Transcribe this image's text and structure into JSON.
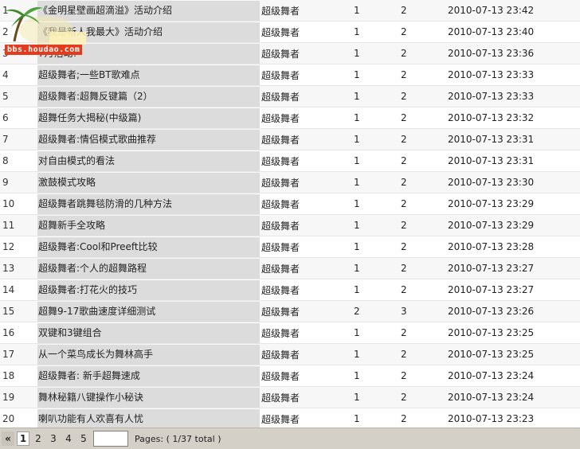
{
  "rows": [
    {
      "no": "1",
      "title": "《金明星壁画超滴溢》活动介绍",
      "author": "超级舞者",
      "a": "1",
      "b": "2",
      "date": "2010-07-13 23:42"
    },
    {
      "no": "2",
      "title": "《我是新人我最大》活动介绍",
      "author": "超级舞者",
      "a": "1",
      "b": "2",
      "date": "2010-07-13 23:40"
    },
    {
      "no": "3",
      "title": "7月活动!",
      "author": "超级舞者",
      "a": "1",
      "b": "2",
      "date": "2010-07-13 23:36"
    },
    {
      "no": "4",
      "title": "超级舞者;一些BT歌难点",
      "author": "超级舞者",
      "a": "1",
      "b": "2",
      "date": "2010-07-13 23:33"
    },
    {
      "no": "5",
      "title": "超级舞者:超舞反键篇（2）",
      "author": "超级舞者",
      "a": "1",
      "b": "2",
      "date": "2010-07-13 23:33"
    },
    {
      "no": "6",
      "title": "超舞任务大揭秘(中级篇)",
      "author": "超级舞者",
      "a": "1",
      "b": "2",
      "date": "2010-07-13 23:32"
    },
    {
      "no": "7",
      "title": "超级舞者:情侣模式歌曲推荐",
      "author": "超级舞者",
      "a": "1",
      "b": "2",
      "date": "2010-07-13 23:31"
    },
    {
      "no": "8",
      "title": "对自由模式的看法",
      "author": "超级舞者",
      "a": "1",
      "b": "2",
      "date": "2010-07-13 23:31"
    },
    {
      "no": "9",
      "title": "激鼓模式攻略",
      "author": "超级舞者",
      "a": "1",
      "b": "2",
      "date": "2010-07-13 23:30"
    },
    {
      "no": "10",
      "title": "超级舞者跳舞毯防滑的几种方法",
      "author": "超级舞者",
      "a": "1",
      "b": "2",
      "date": "2010-07-13 23:29"
    },
    {
      "no": "11",
      "title": "超舞新手全攻略",
      "author": "超级舞者",
      "a": "1",
      "b": "2",
      "date": "2010-07-13 23:29"
    },
    {
      "no": "12",
      "title": "超级舞者:Cool和Preeft比较",
      "author": "超级舞者",
      "a": "1",
      "b": "2",
      "date": "2010-07-13 23:28"
    },
    {
      "no": "13",
      "title": "超级舞者:个人的超舞路程",
      "author": "超级舞者",
      "a": "1",
      "b": "2",
      "date": "2010-07-13 23:27"
    },
    {
      "no": "14",
      "title": "超级舞者:打花火的技巧",
      "author": "超级舞者",
      "a": "1",
      "b": "2",
      "date": "2010-07-13 23:27"
    },
    {
      "no": "15",
      "title": "超舞9-17歌曲速度详细测试",
      "author": "超级舞者",
      "a": "2",
      "b": "3",
      "date": "2010-07-13 23:26"
    },
    {
      "no": "16",
      "title": "双键和3键组合",
      "author": "超级舞者",
      "a": "1",
      "b": "2",
      "date": "2010-07-13 23:25"
    },
    {
      "no": "17",
      "title": "从一个菜鸟成长为舞林高手",
      "author": "超级舞者",
      "a": "1",
      "b": "2",
      "date": "2010-07-13 23:25"
    },
    {
      "no": "18",
      "title": "超级舞者: 新手超舞速成",
      "author": "超级舞者",
      "a": "1",
      "b": "2",
      "date": "2010-07-13 23:24"
    },
    {
      "no": "19",
      "title": "舞林秘籍八键操作小秘诀",
      "author": "超级舞者",
      "a": "1",
      "b": "2",
      "date": "2010-07-13 23:24"
    },
    {
      "no": "20",
      "title": "喇叭功能有人欢喜有人忧",
      "author": "超级舞者",
      "a": "1",
      "b": "2",
      "date": "2010-07-13 23:23"
    }
  ],
  "logo": {
    "text": "bbs.houdao.com"
  },
  "pager": {
    "first": "«",
    "pages": [
      "1",
      "2",
      "3",
      "4",
      "5"
    ],
    "current": "1",
    "jump_value": "",
    "info": "Pages: ( 1/37 total )"
  },
  "colors": {
    "row_odd": "#f7f7f7",
    "row_even": "#ffffff",
    "title_bg": "#dcdcdc",
    "pager_bg": "#d4d0c8",
    "logo_badge": "#e23b1e"
  }
}
